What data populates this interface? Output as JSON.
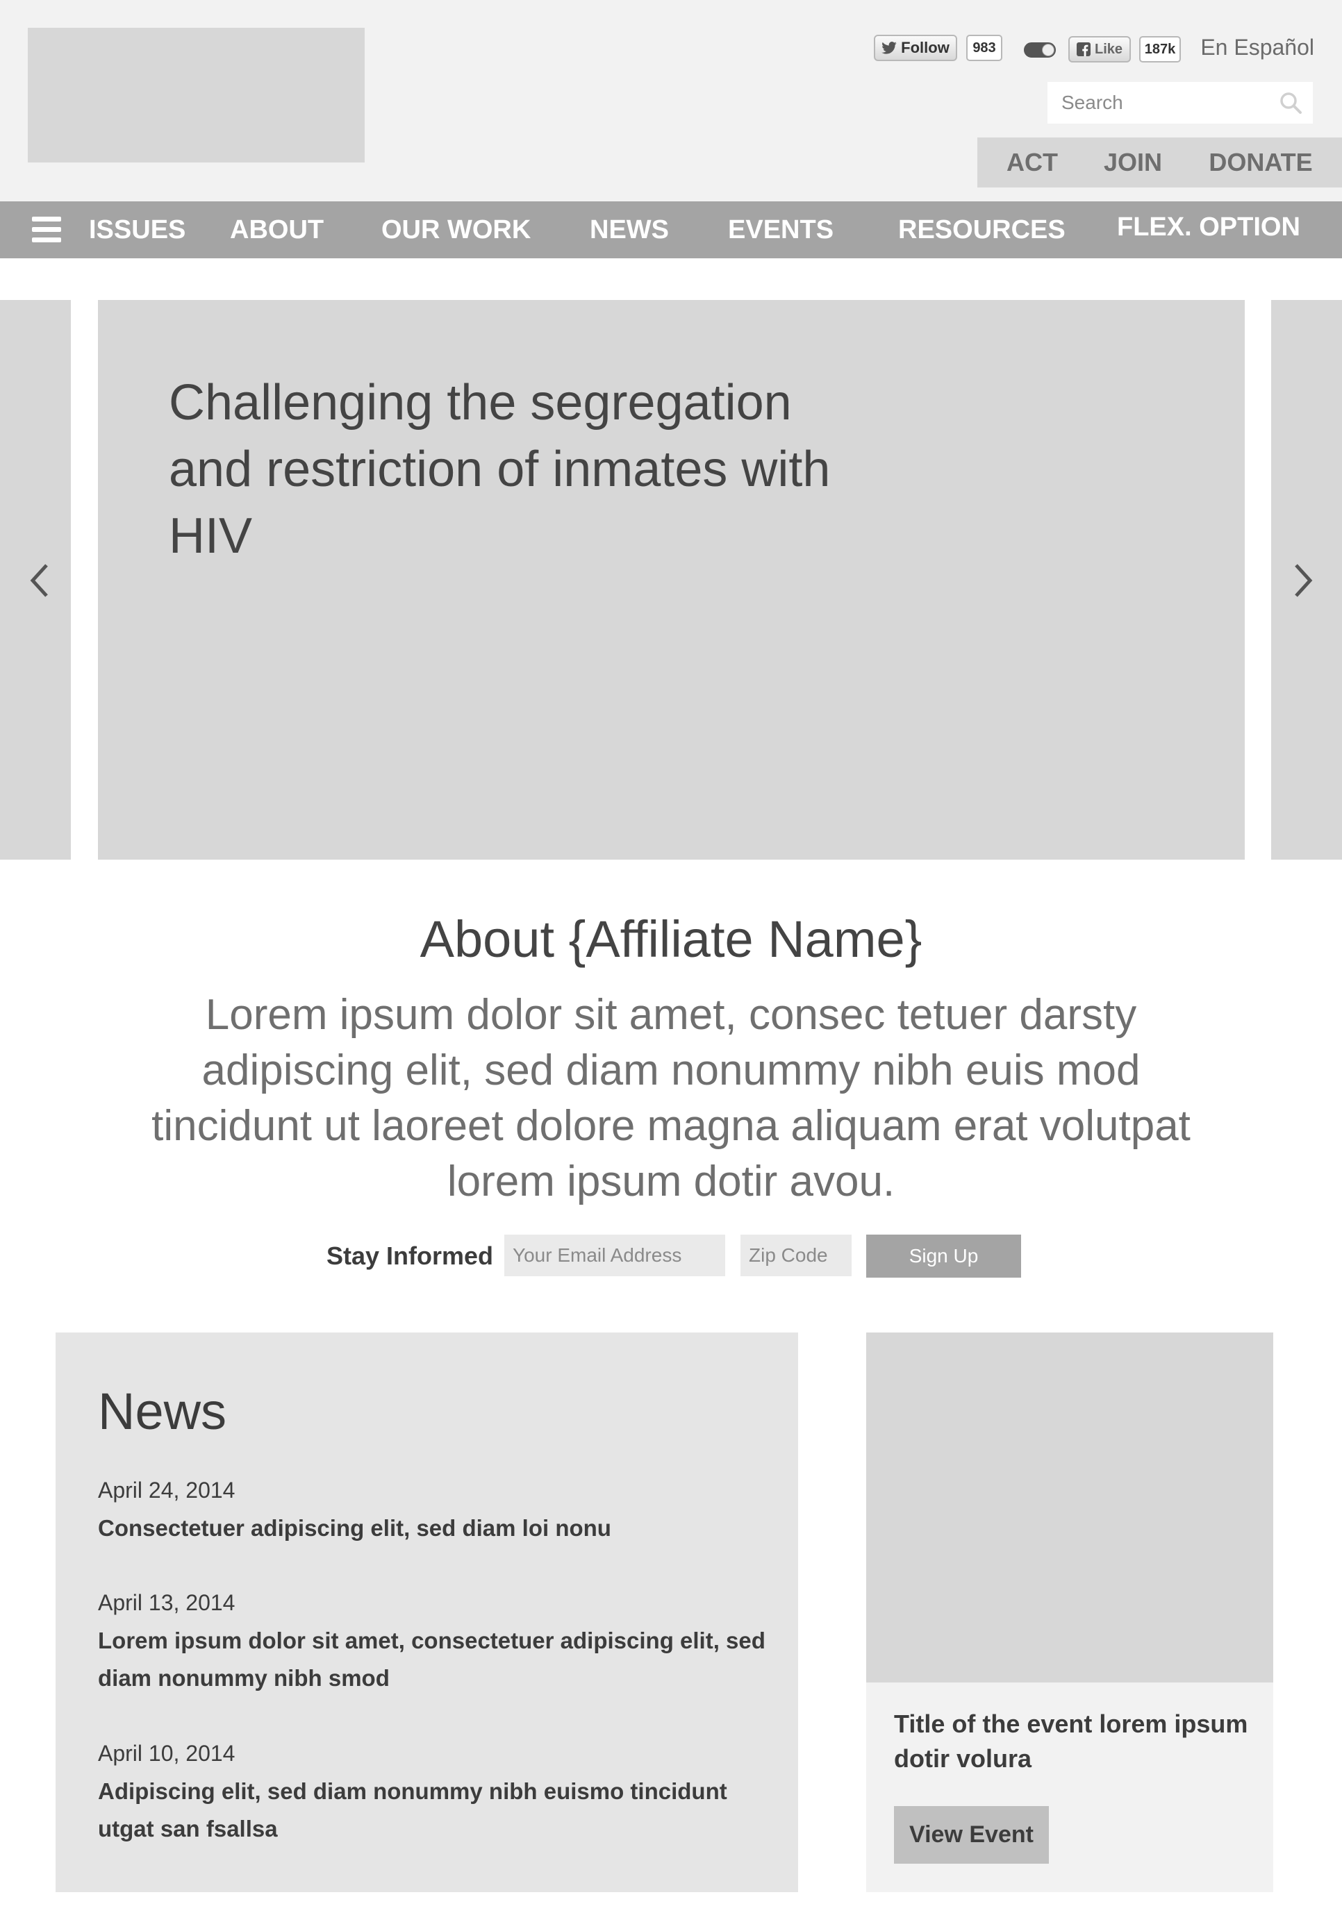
{
  "header": {
    "twitter": {
      "follow_label": "Follow",
      "count": "983"
    },
    "facebook": {
      "like_label": "Like",
      "count": "187k"
    },
    "language_link": "En Español",
    "search": {
      "placeholder": "Search"
    },
    "actions": [
      "ACT",
      "JOIN",
      "DONATE"
    ]
  },
  "nav": {
    "items": [
      "ISSUES",
      "ABOUT",
      "OUR WORK",
      "NEWS",
      "EVENTS",
      "RESOURCES",
      "FLEX. OPTION"
    ]
  },
  "hero": {
    "title": "Challenging the segregation and restriction of inmates with HIV"
  },
  "about": {
    "title": "About {Affiliate Name}",
    "text": "Lorem ipsum dolor sit amet, consec tetuer darsty adipiscing elit, sed diam nonummy nibh euis mod tincidunt ut laoreet dolore magna aliquam erat volutpat lorem ipsum dotir avou."
  },
  "signup": {
    "label": "Stay Informed",
    "email_placeholder": "Your Email Address",
    "zip_placeholder": "Zip Code",
    "button": "Sign Up"
  },
  "news": {
    "title": "News",
    "items": [
      {
        "date": "April 24, 2014",
        "headline": "Consectetuer adipiscing elit, sed diam loi nonu"
      },
      {
        "date": "April 13, 2014",
        "headline": "Lorem ipsum dolor sit amet, consectetuer adipiscing elit, sed diam nonummy nibh smod"
      },
      {
        "date": "April 10, 2014",
        "headline": "Adipiscing elit, sed diam nonummy nibh euismo tincidunt utgat san fsallsa"
      }
    ]
  },
  "event": {
    "title": "Title of the event lorem ipsum dotir volura",
    "button": "View Event"
  },
  "icons": {
    "search": "search-icon",
    "menu": "hamburger-menu-icon",
    "prev": "chevron-left-icon",
    "next": "chevron-right-icon",
    "twitter": "twitter-bird-icon",
    "facebook": "facebook-f-icon"
  }
}
